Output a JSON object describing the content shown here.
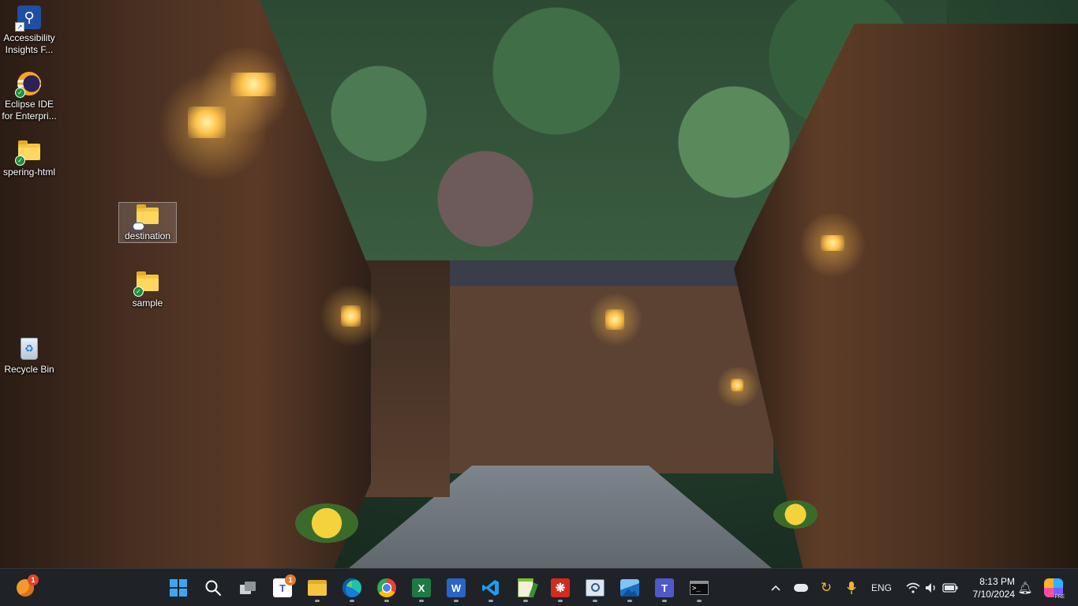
{
  "desktop": {
    "icons": [
      {
        "label": "Accessibility Insights F...",
        "icon": "accessibility-insights-icon"
      },
      {
        "label": "Eclipse IDE for Enterpri...",
        "icon": "eclipse-icon"
      },
      {
        "label": "spering-html",
        "icon": "folder-icon"
      },
      {
        "label": "destination",
        "icon": "folder-icon"
      },
      {
        "label": "sample",
        "icon": "folder-icon"
      },
      {
        "label": "Recycle Bin",
        "icon": "recycle-bin-icon"
      }
    ]
  },
  "taskbar": {
    "widgets_badge": "1",
    "teams_badge": "1",
    "apps": [
      {
        "name": "start",
        "glyph": "start-icon"
      },
      {
        "name": "search",
        "glyph": "search-icon"
      },
      {
        "name": "task-view",
        "glyph": "task-view-icon"
      },
      {
        "name": "teams",
        "glyph": "teams-icon"
      },
      {
        "name": "file-explorer",
        "glyph": "folder-icon"
      },
      {
        "name": "edge",
        "glyph": "edge-icon"
      },
      {
        "name": "chrome",
        "glyph": "chrome-icon"
      },
      {
        "name": "excel",
        "glyph": "excel-icon"
      },
      {
        "name": "word",
        "glyph": "word-icon"
      },
      {
        "name": "vscode",
        "glyph": "vscode-icon"
      },
      {
        "name": "notepad-plus",
        "glyph": "notepad-icon"
      },
      {
        "name": "acrobat",
        "glyph": "acrobat-icon"
      },
      {
        "name": "network-tool",
        "glyph": "network-icon"
      },
      {
        "name": "photos",
        "glyph": "photos-icon"
      },
      {
        "name": "teams-work",
        "glyph": "teams-icon"
      },
      {
        "name": "terminal",
        "glyph": "terminal-icon"
      }
    ],
    "tray": {
      "language": "ENG",
      "time": "8:13 PM",
      "date": "7/10/2024"
    }
  }
}
